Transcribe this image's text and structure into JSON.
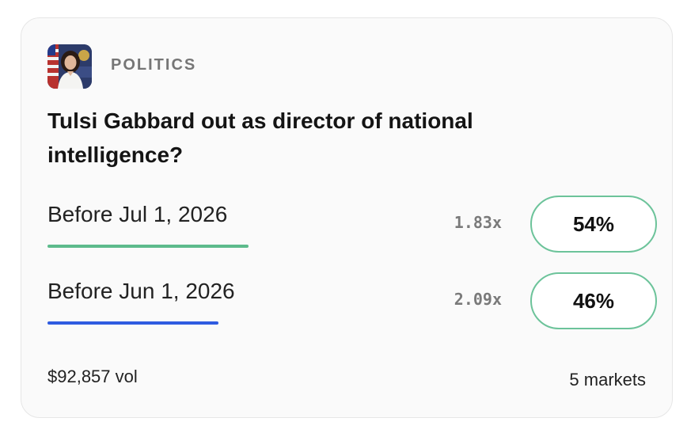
{
  "market": {
    "category": "POLITICS",
    "title": "Tulsi Gabbard out as director of national intelligence?",
    "outcomes": [
      {
        "label": "Before Jul 1, 2026",
        "multiplier": "1.83x",
        "percent": "54%",
        "probability": 0.54,
        "bar_color": "#5dbb8c"
      },
      {
        "label": "Before Jun 1, 2026",
        "multiplier": "2.09x",
        "percent": "46%",
        "probability": 0.46,
        "bar_color": "#2f5be0"
      }
    ],
    "volume": "$92,857 vol",
    "markets_count": "5 markets"
  },
  "theme": {
    "card_background": "#fafafa",
    "button_border": "#6cc39a",
    "muted_text": "#767676"
  },
  "icons": {
    "avatar": "person-portrait-avatar"
  }
}
